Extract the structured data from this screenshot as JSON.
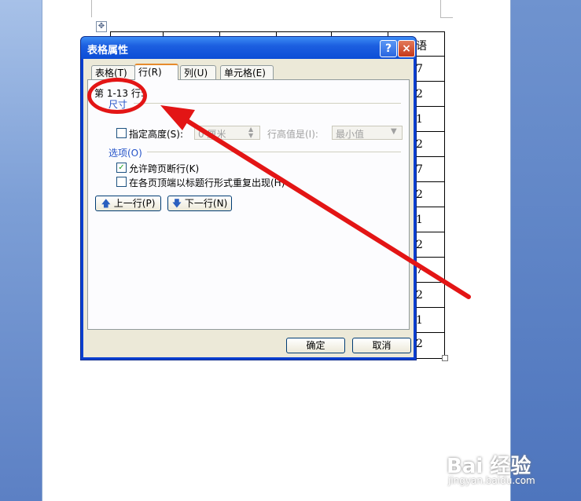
{
  "document": {
    "table_cells": [
      "语",
      "7",
      "2",
      "1",
      "2",
      "7",
      "2",
      "1",
      "2",
      "7",
      "2",
      "1",
      "2"
    ]
  },
  "dialog": {
    "title": "表格属性",
    "help": "?",
    "close": "×",
    "tabs": [
      {
        "label": "表格(T)",
        "active": false
      },
      {
        "label": "行(R)",
        "active": true
      },
      {
        "label": "列(U)",
        "active": false
      },
      {
        "label": "单元格(E)",
        "active": false
      }
    ],
    "rows_label": "第 1-13 行:",
    "size_section": "尺寸",
    "specify_height_label": "指定高度(S):",
    "height_value": "0 厘米",
    "row_height_is_label": "行高值是(I):",
    "row_height_mode": "最小值",
    "options_section": "选项(O)",
    "allow_break_label": "允许跨页断行(K)",
    "repeat_header_label": "在各页顶端以标题行形式重复出现(H)",
    "prev_row_button": "上一行(P)",
    "next_row_button": "下一行(N)",
    "ok_button": "确定",
    "cancel_button": "取消"
  },
  "watermark": {
    "brand": "Bai 经验",
    "url": "jingyan.baidu.com"
  },
  "colors": {
    "annotation_red": "#e31515",
    "xp_title_blue": "#0c4dd6"
  }
}
